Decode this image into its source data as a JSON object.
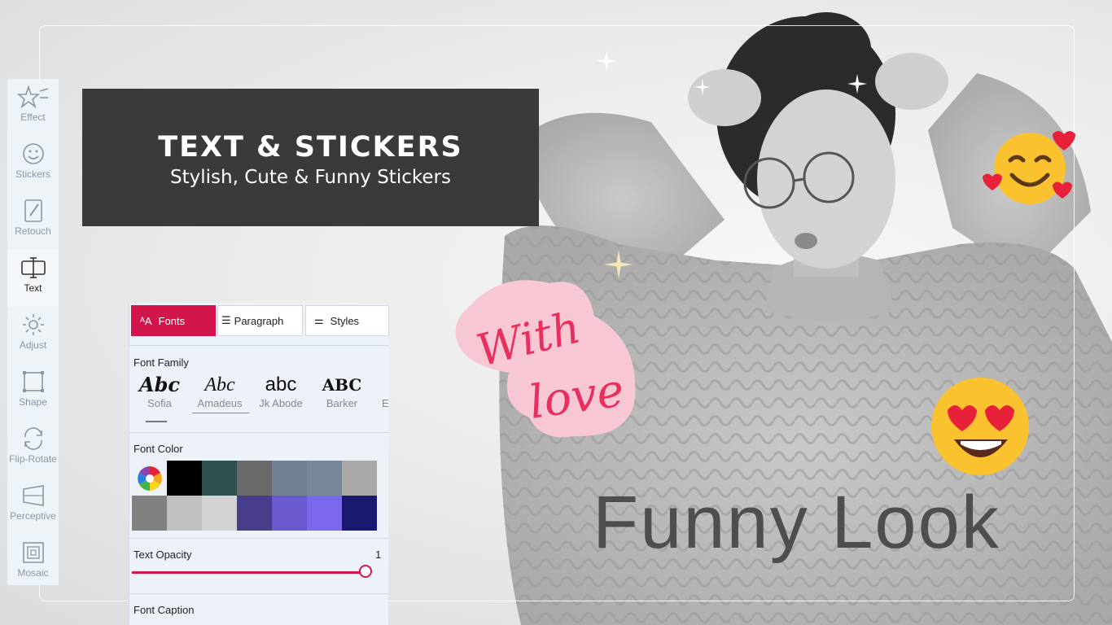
{
  "banner": {
    "title": "TEXT & STICKERS",
    "subtitle": "Stylish, Cute & Funny Stickers"
  },
  "tools": [
    {
      "label": "Effect",
      "icon": "stars-icon"
    },
    {
      "label": "Stickers",
      "icon": "smiley-icon"
    },
    {
      "label": "Retouch",
      "icon": "retouch-icon"
    },
    {
      "label": "Text",
      "icon": "text-icon"
    },
    {
      "label": "Adjust",
      "icon": "brightness-icon"
    },
    {
      "label": "Shape",
      "icon": "shape-icon"
    },
    {
      "label": "Flip-Rotate",
      "icon": "rotate-icon"
    },
    {
      "label": "Perceptive",
      "icon": "perspective-icon"
    },
    {
      "label": "Mosaic",
      "icon": "mosaic-icon"
    }
  ],
  "active_tool": "Text",
  "panel": {
    "tabs": [
      {
        "label": "Fonts",
        "icon": "font-size-icon"
      },
      {
        "label": "Paragraph",
        "icon": "list-icon"
      },
      {
        "label": "Styles",
        "icon": "sliders-icon"
      }
    ],
    "font_family_title": "Font Family",
    "fonts": [
      {
        "sample": "Abc",
        "name": "Sofia"
      },
      {
        "sample": "Abc",
        "name": "Amadeus"
      },
      {
        "sample": "abc",
        "name": "Jk Abode"
      },
      {
        "sample": "ABC",
        "name": "Barker"
      },
      {
        "sample": "",
        "name": "E"
      }
    ],
    "font_color_title": "Font Color",
    "colors_row1": [
      "#000000",
      "#2f4f4f",
      "#696969",
      "#708090",
      "#778899",
      "#a9a9a9"
    ],
    "colors_row2": [
      "#808080",
      "#c0c0c0",
      "#d3d3d3",
      "#483d8b",
      "#6a5acd",
      "#7b68ee",
      "#191970"
    ],
    "opacity_title": "Text Opacity",
    "opacity_value": "1",
    "opacity_fraction": 1,
    "caption_title": "Font Caption",
    "accent": "#d2164c"
  },
  "canvas": {
    "sticker_with_love_1": "With",
    "sticker_with_love_2": "love",
    "overlay_text": "Funny Look",
    "sticker_1": "smiling-face-with-hearts-emoji",
    "sticker_2": "heart-eyes-emoji"
  }
}
